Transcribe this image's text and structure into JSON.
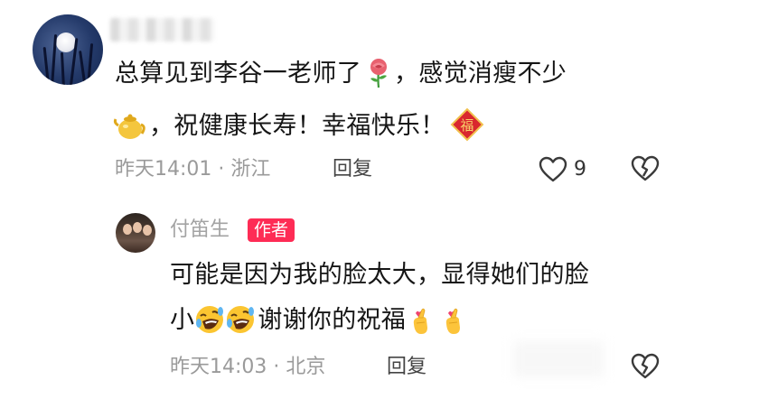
{
  "comment": {
    "line1": "总算见到李谷一老师了",
    "line1_tail": "，感觉消瘦不少",
    "line2": "，祝健康长寿！幸福快乐！",
    "time": "昨天14:01",
    "location": "浙江",
    "reply_label": "回复",
    "like_count": "9",
    "icons": {
      "rose": "rose-emoji",
      "teapot": "teapot-emoji",
      "fu": "fu-blessing-emoji",
      "like": "heart-outline-icon",
      "dislike": "broken-heart-icon"
    }
  },
  "reply": {
    "author": "付笛生",
    "badge": "作者",
    "line1": "可能是因为我的脸太大，显得她们的脸",
    "line2_a": "小",
    "line2_b": "谢谢你的祝福",
    "time": "昨天14:03",
    "location": "北京",
    "reply_label": "回复",
    "icons": {
      "laugh": "rolling-laughing-emoji",
      "finger_heart": "finger-heart-emoji",
      "dislike": "broken-heart-icon"
    }
  },
  "separator": " · ",
  "colors": {
    "text": "#161616",
    "meta": "#9a9a9a",
    "badge": "#fe2c55"
  }
}
